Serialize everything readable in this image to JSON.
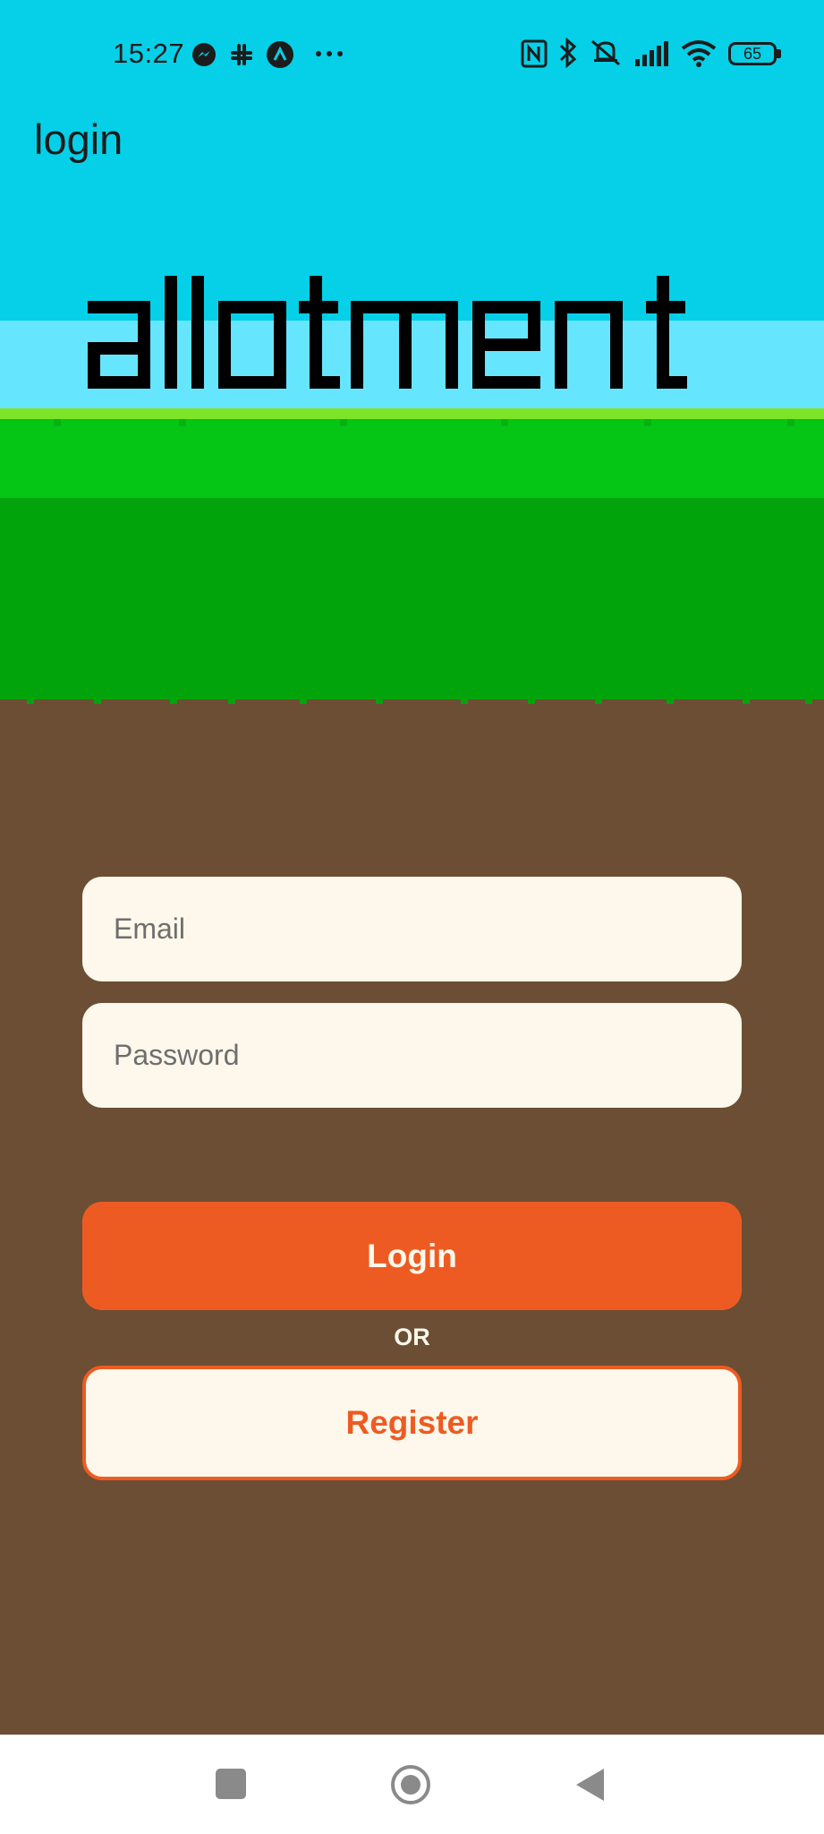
{
  "status_bar": {
    "time": "15:27",
    "battery": "65",
    "icons": [
      "messenger-icon",
      "slack-icon",
      "arc-icon",
      "more-icon",
      "nfc-icon",
      "bluetooth-icon",
      "mute-icon",
      "signal-icon",
      "wifi-icon",
      "battery-icon"
    ]
  },
  "header": {
    "title": "login"
  },
  "logo": {
    "text": "allotment"
  },
  "form": {
    "email_placeholder": "Email",
    "password_placeholder": "Password",
    "login_label": "Login",
    "or_label": "OR",
    "register_label": "Register"
  },
  "nav_bar": {
    "icons": [
      "recents-icon",
      "home-icon",
      "back-icon"
    ]
  },
  "colors": {
    "sky": "#05d0e8",
    "sky_band": "#66e5ff",
    "grass_light": "#05c515",
    "grass_dark": "#02a40c",
    "soil": "#6c4e34",
    "accent": "#ee5b22",
    "cream": "#fdf8eb"
  }
}
